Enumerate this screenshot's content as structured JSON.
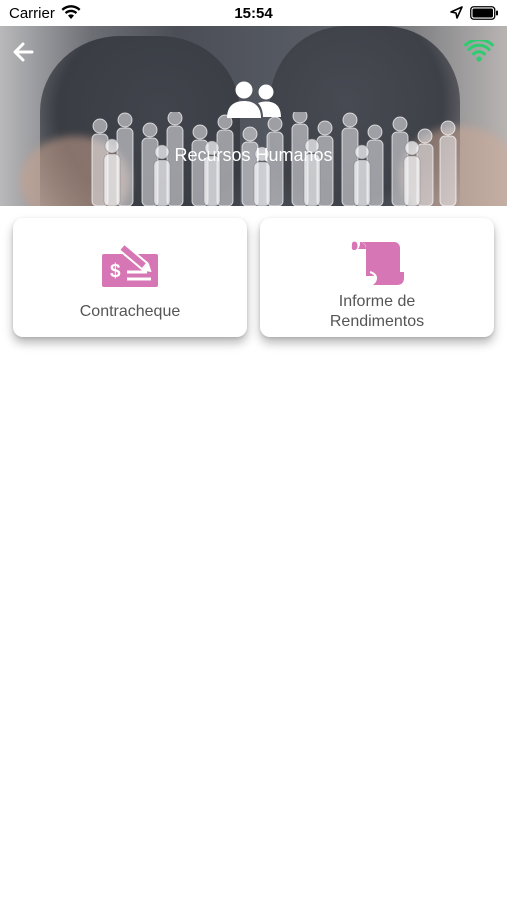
{
  "status_bar": {
    "carrier": "Carrier",
    "time": "15:54"
  },
  "header": {
    "title": "Recursos Humanos",
    "icons": {
      "back": "back-arrow-icon",
      "connection": "wifi-icon",
      "section": "people-icon"
    },
    "connection_color": "#2ecc71"
  },
  "cards": [
    {
      "label": "Contracheque",
      "icon": "paycheck-icon"
    },
    {
      "label_lines": [
        "Informe de",
        "Rendimentos"
      ],
      "icon": "scroll-icon"
    }
  ],
  "colors": {
    "accent": "#d676b4",
    "card_text": "#555555"
  }
}
